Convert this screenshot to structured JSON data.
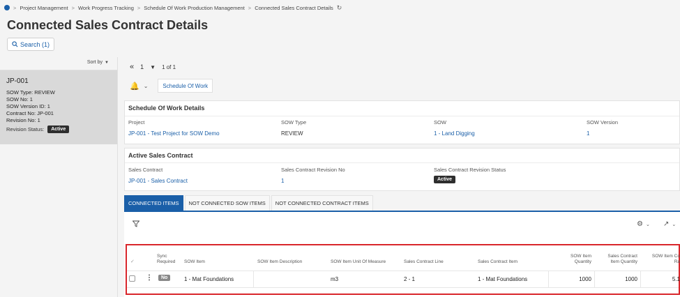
{
  "breadcrumb": {
    "items": [
      "Project Management",
      "Work Progress Tracking",
      "Schedule Of Work Production Management",
      "Connected Sales Contract Details"
    ]
  },
  "page": {
    "title": "Connected Sales Contract Details",
    "search_label": "Search (1)"
  },
  "list": {
    "sort_label": "Sort by",
    "card": {
      "title": "JP-001",
      "sow_type": "SOW Type:  REVIEW",
      "sow_no": "SOW No:  1",
      "sow_version": "SOW Version ID:  1",
      "contract_no": "Contract No:  JP-001",
      "revision_no": "Revision No:  1",
      "revision_status_label": "Revision Status:",
      "revision_status": "Active"
    }
  },
  "pager": {
    "current": "1",
    "of_text": "1 of 1"
  },
  "toolbar": {
    "sow_button": "Schedule Of Work"
  },
  "sow_details": {
    "heading": "Schedule Of Work Details",
    "project_label": "Project",
    "project_value": "JP-001 - Test Project for SOW Demo",
    "sow_type_label": "SOW Type",
    "sow_type_value": "REVIEW",
    "sow_label": "SOW",
    "sow_value": "1 - Land Digging",
    "sow_version_label": "SOW Version",
    "sow_version_value": "1"
  },
  "active_contract": {
    "heading": "Active Sales Contract",
    "contract_label": "Sales Contract",
    "contract_value": "JP-001 - Sales Contract",
    "revision_label": "Sales Contract Revision No",
    "revision_value": "1",
    "status_label": "Sales Contract Revision Status",
    "status_value": "Active"
  },
  "tabs": [
    {
      "label": "CONNECTED ITEMS"
    },
    {
      "label": "NOT CONNECTED SOW ITEMS"
    },
    {
      "label": "NOT CONNECTED CONTRACT ITEMS"
    }
  ],
  "table": {
    "headers": {
      "sync_required_1": "Sync",
      "sync_required_2": "Required",
      "sow_item": "SOW Item",
      "sow_item_desc": "SOW Item Description",
      "uom": "SOW Item Unit Of Measure",
      "contract_line": "Sales Contract Line",
      "contract_item": "Sales Contract Item",
      "sow_qty_1": "SOW Item",
      "sow_qty_2": "Quantity",
      "contract_qty_1": "Sales Contract",
      "contract_qty_2": "Item Quantity",
      "rate_1": "SOW Item Co",
      "rate_2": "Ra"
    },
    "rows": [
      {
        "sync": "No",
        "sow_item": "1 -  Mat Foundations",
        "sow_item_desc": "",
        "uom": "m3",
        "contract_line": "2 - 1",
        "contract_item": "1 -  Mat Foundations",
        "sow_qty": "1000",
        "contract_qty": "1000",
        "rate": "5.1"
      }
    ]
  },
  "colors": {
    "accent": "#1a5fa8",
    "highlight_border": "#d9262b",
    "badge_dark": "#2e2e2e"
  }
}
